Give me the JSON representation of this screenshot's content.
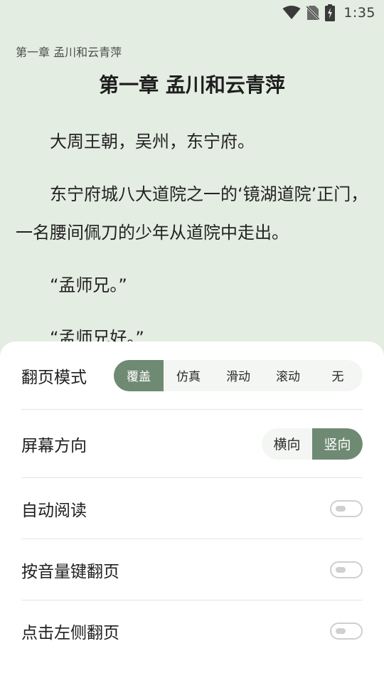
{
  "status_bar": {
    "time": "1:35",
    "icons": [
      "wifi-icon",
      "no-sim-icon",
      "battery-charging-icon"
    ]
  },
  "reader": {
    "chapter_header": "第一章 孟川和云青萍",
    "chapter_title": "第一章 孟川和云青萍",
    "paragraphs": [
      "大周王朝，吴州，东宁府。",
      "东宁府城八大道院之一的‘镜湖道院’正门，一名腰间佩刀的少年从道院中走出。",
      "“孟师兄。”",
      "“孟师兄好。”"
    ]
  },
  "settings": {
    "page_mode": {
      "label": "翻页模式",
      "options": [
        "覆盖",
        "仿真",
        "滑动",
        "滚动",
        "无"
      ],
      "selected": "覆盖"
    },
    "orientation": {
      "label": "屏幕方向",
      "options": [
        "横向",
        "竖向"
      ],
      "selected": "竖向"
    },
    "auto_read": {
      "label": "自动阅读",
      "enabled": false
    },
    "volume_key_turn": {
      "label": "按音量键翻页",
      "enabled": false
    },
    "tap_left_turn": {
      "label": "点击左侧翻页",
      "enabled": false
    }
  },
  "colors": {
    "background": "#e4ede2",
    "accent": "#6f8a73"
  }
}
